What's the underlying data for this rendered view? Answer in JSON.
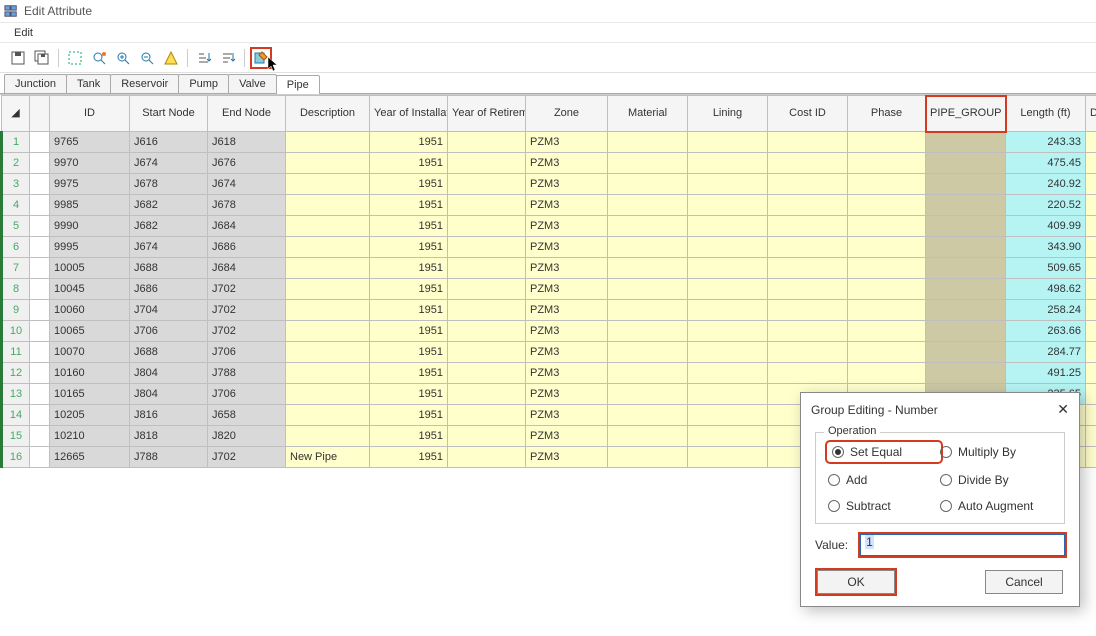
{
  "window": {
    "title": "Edit Attribute"
  },
  "menu": {
    "edit": "Edit"
  },
  "tabs": [
    "Junction",
    "Tank",
    "Reservoir",
    "Pump",
    "Valve",
    "Pipe"
  ],
  "active_tab": 5,
  "columns": [
    "ID",
    "Start Node",
    "End Node",
    "Description",
    "Year of Installation",
    "Year of Retirement",
    "Zone",
    "Material",
    "Lining",
    "Cost ID",
    "Phase",
    "PIPE_GROUP",
    "Length (ft)",
    "Diam"
  ],
  "rows": [
    {
      "n": 1,
      "id": "9765",
      "sn": "J616",
      "en": "J618",
      "desc": "",
      "yoi": "1951",
      "yor": "",
      "zone": "PZM3",
      "len": "243.33"
    },
    {
      "n": 2,
      "id": "9970",
      "sn": "J674",
      "en": "J676",
      "desc": "",
      "yoi": "1951",
      "yor": "",
      "zone": "PZM3",
      "len": "475.45"
    },
    {
      "n": 3,
      "id": "9975",
      "sn": "J678",
      "en": "J674",
      "desc": "",
      "yoi": "1951",
      "yor": "",
      "zone": "PZM3",
      "len": "240.92"
    },
    {
      "n": 4,
      "id": "9985",
      "sn": "J682",
      "en": "J678",
      "desc": "",
      "yoi": "1951",
      "yor": "",
      "zone": "PZM3",
      "len": "220.52"
    },
    {
      "n": 5,
      "id": "9990",
      "sn": "J682",
      "en": "J684",
      "desc": "",
      "yoi": "1951",
      "yor": "",
      "zone": "PZM3",
      "len": "409.99"
    },
    {
      "n": 6,
      "id": "9995",
      "sn": "J674",
      "en": "J686",
      "desc": "",
      "yoi": "1951",
      "yor": "",
      "zone": "PZM3",
      "len": "343.90"
    },
    {
      "n": 7,
      "id": "10005",
      "sn": "J688",
      "en": "J684",
      "desc": "",
      "yoi": "1951",
      "yor": "",
      "zone": "PZM3",
      "len": "509.65"
    },
    {
      "n": 8,
      "id": "10045",
      "sn": "J686",
      "en": "J702",
      "desc": "",
      "yoi": "1951",
      "yor": "",
      "zone": "PZM3",
      "len": "498.62"
    },
    {
      "n": 9,
      "id": "10060",
      "sn": "J704",
      "en": "J702",
      "desc": "",
      "yoi": "1951",
      "yor": "",
      "zone": "PZM3",
      "len": "258.24"
    },
    {
      "n": 10,
      "id": "10065",
      "sn": "J706",
      "en": "J702",
      "desc": "",
      "yoi": "1951",
      "yor": "",
      "zone": "PZM3",
      "len": "263.66"
    },
    {
      "n": 11,
      "id": "10070",
      "sn": "J688",
      "en": "J706",
      "desc": "",
      "yoi": "1951",
      "yor": "",
      "zone": "PZM3",
      "len": "284.77"
    },
    {
      "n": 12,
      "id": "10160",
      "sn": "J804",
      "en": "J788",
      "desc": "",
      "yoi": "1951",
      "yor": "",
      "zone": "PZM3",
      "len": "491.25"
    },
    {
      "n": 13,
      "id": "10165",
      "sn": "J804",
      "en": "J706",
      "desc": "",
      "yoi": "1951",
      "yor": "",
      "zone": "PZM3",
      "len": "235.65"
    },
    {
      "n": 14,
      "id": "10205",
      "sn": "J816",
      "en": "J658",
      "desc": "",
      "yoi": "1951",
      "yor": "",
      "zone": "PZM3",
      "len": ""
    },
    {
      "n": 15,
      "id": "10210",
      "sn": "J818",
      "en": "J820",
      "desc": "",
      "yoi": "1951",
      "yor": "",
      "zone": "PZM3",
      "len": ""
    },
    {
      "n": 16,
      "id": "12665",
      "sn": "J788",
      "en": "J702",
      "desc": "New Pipe",
      "yoi": "1951",
      "yor": "",
      "zone": "PZM3",
      "len": ""
    }
  ],
  "dialog": {
    "title": "Group Editing - Number",
    "operation_legend": "Operation",
    "ops": {
      "set_equal": "Set Equal",
      "multiply": "Multiply By",
      "add": "Add",
      "divide": "Divide By",
      "subtract": "Subtract",
      "auto": "Auto Augment"
    },
    "value_label": "Value:",
    "value": "1",
    "ok": "OK",
    "cancel": "Cancel"
  }
}
